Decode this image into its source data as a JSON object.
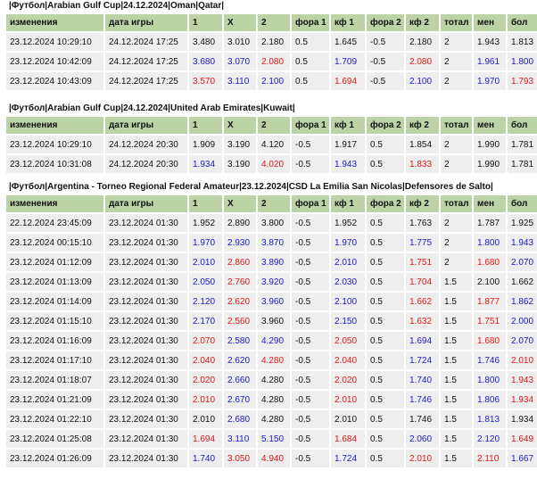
{
  "columns": [
    "изменения",
    "дата игры",
    "1",
    "X",
    "2",
    "фора 1",
    "кф 1",
    "фора 2",
    "кф 2",
    "тотал",
    "мен",
    "бол"
  ],
  "sections": [
    {
      "title": "|Футбол|Arabian Gulf Cup|24.12.2024|Oman|Qatar|",
      "rows": [
        [
          [
            "23.12.2024 10:29:10",
            ""
          ],
          [
            "24.12.2024 17:25",
            ""
          ],
          [
            "3.480",
            ""
          ],
          [
            "3.010",
            ""
          ],
          [
            "2.180",
            ""
          ],
          [
            "0.5",
            ""
          ],
          [
            "1.645",
            ""
          ],
          [
            "-0.5",
            ""
          ],
          [
            "2.180",
            ""
          ],
          [
            "2",
            ""
          ],
          [
            "1.943",
            ""
          ],
          [
            "1.813",
            ""
          ]
        ],
        [
          [
            "23.12.2024 10:42:09",
            ""
          ],
          [
            "24.12.2024 17:25",
            ""
          ],
          [
            "3.680",
            "blue"
          ],
          [
            "3.070",
            "blue"
          ],
          [
            "2.080",
            "red"
          ],
          [
            "0.5",
            ""
          ],
          [
            "1.709",
            "blue"
          ],
          [
            "-0.5",
            ""
          ],
          [
            "2.080",
            "red"
          ],
          [
            "2",
            ""
          ],
          [
            "1.961",
            "blue"
          ],
          [
            "1.800",
            "blue"
          ]
        ],
        [
          [
            "23.12.2024 10:43:09",
            ""
          ],
          [
            "24.12.2024 17:25",
            ""
          ],
          [
            "3.570",
            "red"
          ],
          [
            "3.110",
            "blue"
          ],
          [
            "2.100",
            "blue"
          ],
          [
            "0.5",
            ""
          ],
          [
            "1.694",
            "red"
          ],
          [
            "-0.5",
            ""
          ],
          [
            "2.100",
            "blue"
          ],
          [
            "2",
            ""
          ],
          [
            "1.970",
            "blue"
          ],
          [
            "1.793",
            "red"
          ]
        ]
      ]
    },
    {
      "title": "|Футбол|Arabian Gulf Cup|24.12.2024|United Arab Emirates|Kuwait|",
      "rows": [
        [
          [
            "23.12.2024 10:29:10",
            ""
          ],
          [
            "24.12.2024 20:30",
            ""
          ],
          [
            "1.909",
            ""
          ],
          [
            "3.190",
            ""
          ],
          [
            "4.120",
            ""
          ],
          [
            "-0.5",
            ""
          ],
          [
            "1.917",
            ""
          ],
          [
            "0.5",
            ""
          ],
          [
            "1.854",
            ""
          ],
          [
            "2",
            ""
          ],
          [
            "1.990",
            ""
          ],
          [
            "1.781",
            ""
          ]
        ],
        [
          [
            "23.12.2024 10:31:08",
            ""
          ],
          [
            "24.12.2024 20:30",
            ""
          ],
          [
            "1.934",
            "blue"
          ],
          [
            "3.190",
            ""
          ],
          [
            "4.020",
            "red"
          ],
          [
            "-0.5",
            ""
          ],
          [
            "1.943",
            "blue"
          ],
          [
            "0.5",
            ""
          ],
          [
            "1.833",
            "red"
          ],
          [
            "2",
            ""
          ],
          [
            "1.990",
            ""
          ],
          [
            "1.781",
            ""
          ]
        ]
      ]
    },
    {
      "title": "|Футбол|Argentina - Torneo Regional Federal Amateur|23.12.2024|CSD La Emilia San Nicolas|Defensores de Salto|",
      "rows": [
        [
          [
            "22.12.2024 23:45:09",
            ""
          ],
          [
            "23.12.2024 01:30",
            ""
          ],
          [
            "1.952",
            ""
          ],
          [
            "2.890",
            ""
          ],
          [
            "3.800",
            ""
          ],
          [
            "-0.5",
            ""
          ],
          [
            "1.952",
            ""
          ],
          [
            "0.5",
            ""
          ],
          [
            "1.763",
            ""
          ],
          [
            "2",
            ""
          ],
          [
            "1.787",
            ""
          ],
          [
            "1.925",
            ""
          ]
        ],
        [
          [
            "23.12.2024 00:15:10",
            ""
          ],
          [
            "23.12.2024 01:30",
            ""
          ],
          [
            "1.970",
            "blue"
          ],
          [
            "2.930",
            "blue"
          ],
          [
            "3.870",
            "blue"
          ],
          [
            "-0.5",
            ""
          ],
          [
            "1.970",
            "blue"
          ],
          [
            "0.5",
            ""
          ],
          [
            "1.775",
            "blue"
          ],
          [
            "2",
            ""
          ],
          [
            "1.800",
            "blue"
          ],
          [
            "1.943",
            "blue"
          ]
        ],
        [
          [
            "23.12.2024 01:12:09",
            ""
          ],
          [
            "23.12.2024 01:30",
            ""
          ],
          [
            "2.010",
            "blue"
          ],
          [
            "2.860",
            "red"
          ],
          [
            "3.890",
            "blue"
          ],
          [
            "-0.5",
            ""
          ],
          [
            "2.010",
            "blue"
          ],
          [
            "0.5",
            ""
          ],
          [
            "1.751",
            "red"
          ],
          [
            "2",
            ""
          ],
          [
            "1.680",
            "red"
          ],
          [
            "2.070",
            "blue"
          ]
        ],
        [
          [
            "23.12.2024 01:13:09",
            ""
          ],
          [
            "23.12.2024 01:30",
            ""
          ],
          [
            "2.050",
            "blue"
          ],
          [
            "2.760",
            "red"
          ],
          [
            "3.920",
            "blue"
          ],
          [
            "-0.5",
            ""
          ],
          [
            "2.030",
            "blue"
          ],
          [
            "0.5",
            ""
          ],
          [
            "1.704",
            "red"
          ],
          [
            "1.5",
            ""
          ],
          [
            "2.100",
            ""
          ],
          [
            "1.662",
            ""
          ]
        ],
        [
          [
            "23.12.2024 01:14:09",
            ""
          ],
          [
            "23.12.2024 01:30",
            ""
          ],
          [
            "2.120",
            "blue"
          ],
          [
            "2.620",
            "red"
          ],
          [
            "3.960",
            "blue"
          ],
          [
            "-0.5",
            ""
          ],
          [
            "2.100",
            "blue"
          ],
          [
            "0.5",
            ""
          ],
          [
            "1.662",
            "red"
          ],
          [
            "1.5",
            ""
          ],
          [
            "1.877",
            "red"
          ],
          [
            "1.862",
            "blue"
          ]
        ],
        [
          [
            "23.12.2024 01:15:10",
            ""
          ],
          [
            "23.12.2024 01:30",
            ""
          ],
          [
            "2.170",
            "blue"
          ],
          [
            "2.560",
            "red"
          ],
          [
            "3.960",
            ""
          ],
          [
            "-0.5",
            ""
          ],
          [
            "2.150",
            "blue"
          ],
          [
            "0.5",
            ""
          ],
          [
            "1.632",
            "red"
          ],
          [
            "1.5",
            ""
          ],
          [
            "1.751",
            "red"
          ],
          [
            "2.000",
            "blue"
          ]
        ],
        [
          [
            "23.12.2024 01:16:09",
            ""
          ],
          [
            "23.12.2024 01:30",
            ""
          ],
          [
            "2.070",
            "red"
          ],
          [
            "2.580",
            "blue"
          ],
          [
            "4.290",
            "blue"
          ],
          [
            "-0.5",
            ""
          ],
          [
            "2.050",
            "red"
          ],
          [
            "0.5",
            ""
          ],
          [
            "1.694",
            "blue"
          ],
          [
            "1.5",
            ""
          ],
          [
            "1.680",
            "red"
          ],
          [
            "2.070",
            "blue"
          ]
        ],
        [
          [
            "23.12.2024 01:17:10",
            ""
          ],
          [
            "23.12.2024 01:30",
            ""
          ],
          [
            "2.040",
            "red"
          ],
          [
            "2.620",
            "blue"
          ],
          [
            "4.280",
            "red"
          ],
          [
            "-0.5",
            ""
          ],
          [
            "2.040",
            "red"
          ],
          [
            "0.5",
            ""
          ],
          [
            "1.724",
            "blue"
          ],
          [
            "1.5",
            ""
          ],
          [
            "1.746",
            "blue"
          ],
          [
            "2.010",
            "red"
          ]
        ],
        [
          [
            "23.12.2024 01:18:07",
            ""
          ],
          [
            "23.12.2024 01:30",
            ""
          ],
          [
            "2.020",
            "red"
          ],
          [
            "2.660",
            "blue"
          ],
          [
            "4.280",
            ""
          ],
          [
            "-0.5",
            ""
          ],
          [
            "2.020",
            "red"
          ],
          [
            "0.5",
            ""
          ],
          [
            "1.740",
            "blue"
          ],
          [
            "1.5",
            ""
          ],
          [
            "1.800",
            "blue"
          ],
          [
            "1.943",
            "red"
          ]
        ],
        [
          [
            "23.12.2024 01:21:09",
            ""
          ],
          [
            "23.12.2024 01:30",
            ""
          ],
          [
            "2.010",
            "red"
          ],
          [
            "2.670",
            "blue"
          ],
          [
            "4.280",
            ""
          ],
          [
            "-0.5",
            ""
          ],
          [
            "2.010",
            "red"
          ],
          [
            "0.5",
            ""
          ],
          [
            "1.746",
            "blue"
          ],
          [
            "1.5",
            ""
          ],
          [
            "1.806",
            "blue"
          ],
          [
            "1.934",
            "red"
          ]
        ],
        [
          [
            "23.12.2024 01:22:10",
            ""
          ],
          [
            "23.12.2024 01:30",
            ""
          ],
          [
            "2.010",
            ""
          ],
          [
            "2.680",
            "blue"
          ],
          [
            "4.280",
            ""
          ],
          [
            "-0.5",
            ""
          ],
          [
            "2.010",
            ""
          ],
          [
            "0.5",
            ""
          ],
          [
            "1.746",
            ""
          ],
          [
            "1.5",
            ""
          ],
          [
            "1.813",
            "blue"
          ],
          [
            "1.934",
            ""
          ]
        ],
        [
          [
            "23.12.2024 01:25:08",
            ""
          ],
          [
            "23.12.2024 01:30",
            ""
          ],
          [
            "1.694",
            "red"
          ],
          [
            "3.110",
            "blue"
          ],
          [
            "5.150",
            "blue"
          ],
          [
            "-0.5",
            ""
          ],
          [
            "1.684",
            "red"
          ],
          [
            "0.5",
            ""
          ],
          [
            "2.060",
            "blue"
          ],
          [
            "1.5",
            ""
          ],
          [
            "2.120",
            "blue"
          ],
          [
            "1.649",
            "red"
          ]
        ],
        [
          [
            "23.12.2024 01:26:09",
            ""
          ],
          [
            "23.12.2024 01:30",
            ""
          ],
          [
            "1.740",
            "blue"
          ],
          [
            "3.050",
            "red"
          ],
          [
            "4.940",
            "red"
          ],
          [
            "-0.5",
            ""
          ],
          [
            "1.724",
            "blue"
          ],
          [
            "0.5",
            ""
          ],
          [
            "2.010",
            "red"
          ],
          [
            "1.5",
            ""
          ],
          [
            "2.110",
            "red"
          ],
          [
            "1.667",
            "blue"
          ]
        ]
      ]
    }
  ]
}
